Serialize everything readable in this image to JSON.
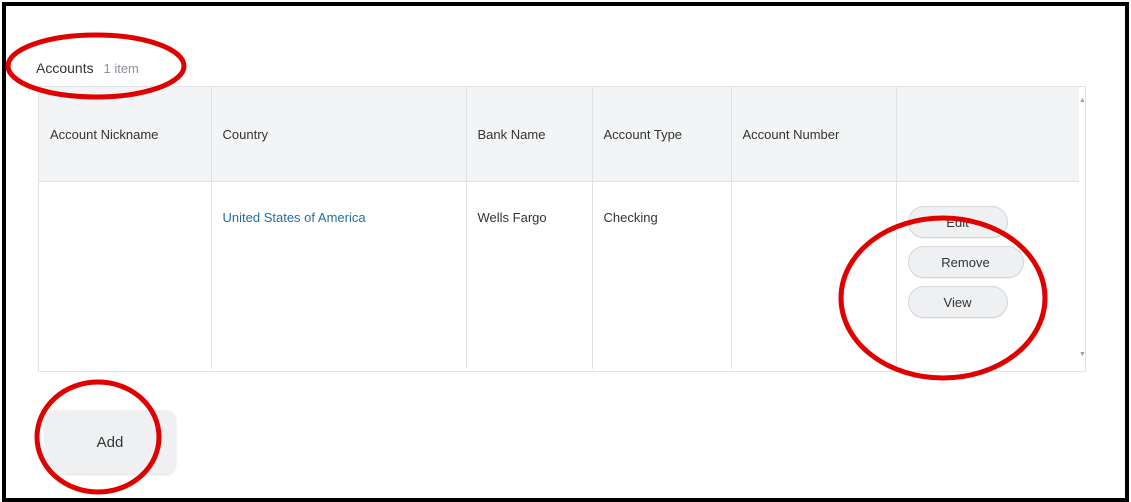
{
  "section": {
    "title": "Accounts",
    "count": "1 item"
  },
  "table": {
    "columns": [
      "Account Nickname",
      "Country",
      "Bank Name",
      "Account Type",
      "Account Number",
      ""
    ],
    "rows": [
      {
        "nickname": "",
        "country": "United States of America",
        "bank_name": "Wells Fargo",
        "account_type": "Checking",
        "account_number": ""
      }
    ]
  },
  "row_actions": {
    "edit": "Edit",
    "remove": "Remove",
    "view": "View"
  },
  "add_button": "Add",
  "colors": {
    "link": "#1f6fa8",
    "annotation": "#e00000",
    "header_bg": "#f3f4f5",
    "button_bg": "#eef0f2"
  },
  "icons": [
    "scroll-up-arrow-icon",
    "scroll-down-arrow-icon"
  ]
}
